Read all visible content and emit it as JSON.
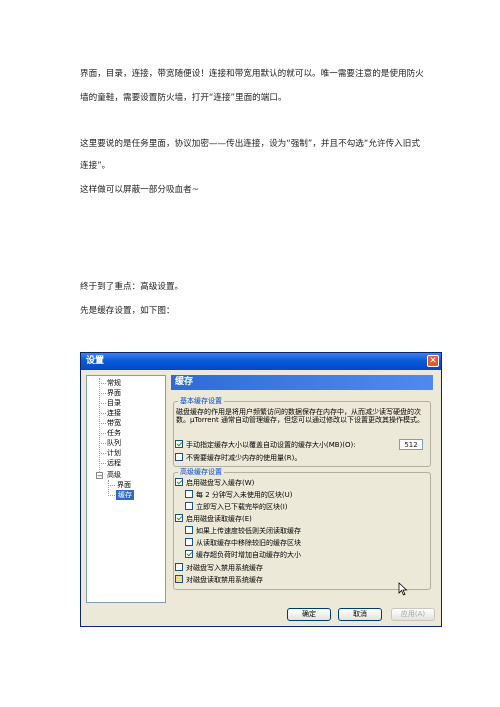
{
  "article": {
    "p1_line1": "界面，目录，连接，带宽随便设！连接和带宽用默认的就可以。唯一需要注意的是使用防火",
    "p1_line2": "墙的童鞋，需要设置防火墙，打开“连接”里面的端口。",
    "p2_line1": "这里要说的是任务里面，协议加密——传出连接，设为“强制”，并且不勾选“允许传入旧式",
    "p2_line2": "连接”。",
    "p3": "这样做可以屏蔽一部分吸血者~",
    "p4": "终于到了重点：高级设置。",
    "p5": "先是缓存设置，如下图："
  },
  "dialog": {
    "title": "设置",
    "tree": [
      "常规",
      "界面",
      "目录",
      "连接",
      "带宽",
      "任务",
      "队列",
      "计划",
      "远程",
      "高级",
      "界面",
      "缓存"
    ],
    "panel_title": "缓存",
    "basic_group": {
      "title": "基本缓存设置",
      "description": "磁盘缓存的作用是将用户频繁访问的数据保存在内存中，从而减少读写硬盘的次数。µTorrent 通常自动管理缓存，但您可以通过修改以下设置更改其操作模式。",
      "override_label": "手动指定缓存大小以覆盖自动设置的缓存大小(MB)(O):",
      "override_value": "512",
      "reduce_label": "不需要缓存时减少内存的使用量(R)。"
    },
    "advanced_group": {
      "title": "高级缓存设置",
      "enable_write": "启用磁盘写入缓存(W)",
      "write_every2min": "每 2 分钟写入未使用的区块(U)",
      "write_finished": "立即写入已下载完毕的区块(I)",
      "enable_read": "启用磁盘读取缓存(E)",
      "turn_off_read_slow": "如果上传速度较低则关闭读取缓存",
      "remove_old_blocks": "从读取缓存中移除较旧的缓存区块",
      "increase_auto": "缓存超负荷时增加自动缓存的大小",
      "no_system_write": "对磁盘写入禁用系统缓存",
      "no_system_read": "对磁盘读取禁用系统缓存"
    },
    "buttons": {
      "ok": "确定",
      "cancel": "取消",
      "apply": "应用(A)"
    }
  }
}
